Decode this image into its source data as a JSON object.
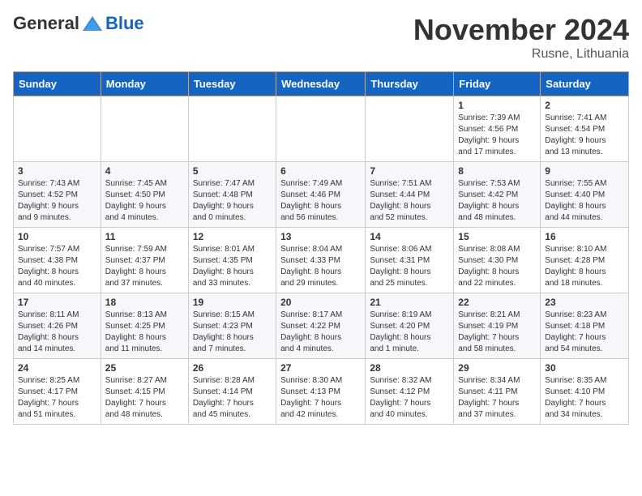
{
  "header": {
    "logo": {
      "general": "General",
      "blue": "Blue"
    },
    "title": "November 2024",
    "location": "Rusne, Lithuania"
  },
  "days_of_week": [
    "Sunday",
    "Monday",
    "Tuesday",
    "Wednesday",
    "Thursday",
    "Friday",
    "Saturday"
  ],
  "weeks": [
    [
      {
        "day": null,
        "info": null
      },
      {
        "day": null,
        "info": null
      },
      {
        "day": null,
        "info": null
      },
      {
        "day": null,
        "info": null
      },
      {
        "day": null,
        "info": null
      },
      {
        "day": "1",
        "info": "Sunrise: 7:39 AM\nSunset: 4:56 PM\nDaylight: 9 hours\nand 17 minutes."
      },
      {
        "day": "2",
        "info": "Sunrise: 7:41 AM\nSunset: 4:54 PM\nDaylight: 9 hours\nand 13 minutes."
      }
    ],
    [
      {
        "day": "3",
        "info": "Sunrise: 7:43 AM\nSunset: 4:52 PM\nDaylight: 9 hours\nand 9 minutes."
      },
      {
        "day": "4",
        "info": "Sunrise: 7:45 AM\nSunset: 4:50 PM\nDaylight: 9 hours\nand 4 minutes."
      },
      {
        "day": "5",
        "info": "Sunrise: 7:47 AM\nSunset: 4:48 PM\nDaylight: 9 hours\nand 0 minutes."
      },
      {
        "day": "6",
        "info": "Sunrise: 7:49 AM\nSunset: 4:46 PM\nDaylight: 8 hours\nand 56 minutes."
      },
      {
        "day": "7",
        "info": "Sunrise: 7:51 AM\nSunset: 4:44 PM\nDaylight: 8 hours\nand 52 minutes."
      },
      {
        "day": "8",
        "info": "Sunrise: 7:53 AM\nSunset: 4:42 PM\nDaylight: 8 hours\nand 48 minutes."
      },
      {
        "day": "9",
        "info": "Sunrise: 7:55 AM\nSunset: 4:40 PM\nDaylight: 8 hours\nand 44 minutes."
      }
    ],
    [
      {
        "day": "10",
        "info": "Sunrise: 7:57 AM\nSunset: 4:38 PM\nDaylight: 8 hours\nand 40 minutes."
      },
      {
        "day": "11",
        "info": "Sunrise: 7:59 AM\nSunset: 4:37 PM\nDaylight: 8 hours\nand 37 minutes."
      },
      {
        "day": "12",
        "info": "Sunrise: 8:01 AM\nSunset: 4:35 PM\nDaylight: 8 hours\nand 33 minutes."
      },
      {
        "day": "13",
        "info": "Sunrise: 8:04 AM\nSunset: 4:33 PM\nDaylight: 8 hours\nand 29 minutes."
      },
      {
        "day": "14",
        "info": "Sunrise: 8:06 AM\nSunset: 4:31 PM\nDaylight: 8 hours\nand 25 minutes."
      },
      {
        "day": "15",
        "info": "Sunrise: 8:08 AM\nSunset: 4:30 PM\nDaylight: 8 hours\nand 22 minutes."
      },
      {
        "day": "16",
        "info": "Sunrise: 8:10 AM\nSunset: 4:28 PM\nDaylight: 8 hours\nand 18 minutes."
      }
    ],
    [
      {
        "day": "17",
        "info": "Sunrise: 8:11 AM\nSunset: 4:26 PM\nDaylight: 8 hours\nand 14 minutes."
      },
      {
        "day": "18",
        "info": "Sunrise: 8:13 AM\nSunset: 4:25 PM\nDaylight: 8 hours\nand 11 minutes."
      },
      {
        "day": "19",
        "info": "Sunrise: 8:15 AM\nSunset: 4:23 PM\nDaylight: 8 hours\nand 7 minutes."
      },
      {
        "day": "20",
        "info": "Sunrise: 8:17 AM\nSunset: 4:22 PM\nDaylight: 8 hours\nand 4 minutes."
      },
      {
        "day": "21",
        "info": "Sunrise: 8:19 AM\nSunset: 4:20 PM\nDaylight: 8 hours\nand 1 minute."
      },
      {
        "day": "22",
        "info": "Sunrise: 8:21 AM\nSunset: 4:19 PM\nDaylight: 7 hours\nand 58 minutes."
      },
      {
        "day": "23",
        "info": "Sunrise: 8:23 AM\nSunset: 4:18 PM\nDaylight: 7 hours\nand 54 minutes."
      }
    ],
    [
      {
        "day": "24",
        "info": "Sunrise: 8:25 AM\nSunset: 4:17 PM\nDaylight: 7 hours\nand 51 minutes."
      },
      {
        "day": "25",
        "info": "Sunrise: 8:27 AM\nSunset: 4:15 PM\nDaylight: 7 hours\nand 48 minutes."
      },
      {
        "day": "26",
        "info": "Sunrise: 8:28 AM\nSunset: 4:14 PM\nDaylight: 7 hours\nand 45 minutes."
      },
      {
        "day": "27",
        "info": "Sunrise: 8:30 AM\nSunset: 4:13 PM\nDaylight: 7 hours\nand 42 minutes."
      },
      {
        "day": "28",
        "info": "Sunrise: 8:32 AM\nSunset: 4:12 PM\nDaylight: 7 hours\nand 40 minutes."
      },
      {
        "day": "29",
        "info": "Sunrise: 8:34 AM\nSunset: 4:11 PM\nDaylight: 7 hours\nand 37 minutes."
      },
      {
        "day": "30",
        "info": "Sunrise: 8:35 AM\nSunset: 4:10 PM\nDaylight: 7 hours\nand 34 minutes."
      }
    ]
  ]
}
